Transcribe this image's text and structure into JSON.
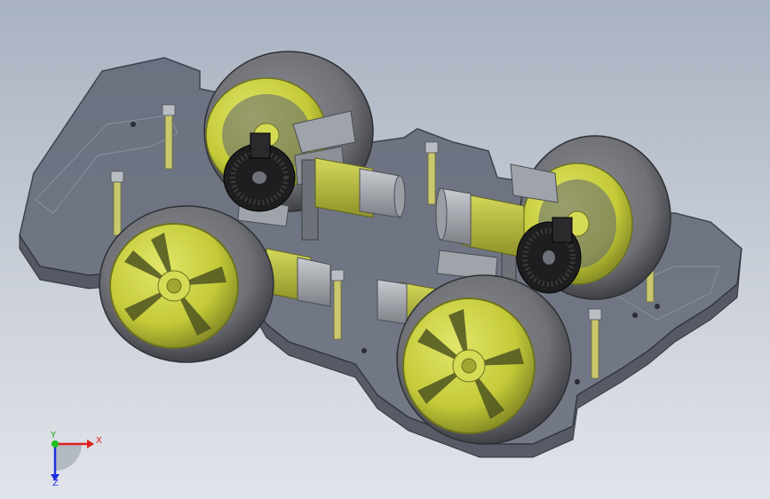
{
  "colors": {
    "background_top": "#a9b2c2",
    "background_bottom": "#e1e4ea",
    "chassis_plate": "#5c6270",
    "chassis_edge": "#3e434e",
    "tire": "#6f7176",
    "tire_dark": "#44464b",
    "rim": "#c8cf3c",
    "rim_dark": "#8c9226",
    "motor_body": "#b6bb3c",
    "motor_cap": "#a3a7ad",
    "bracket": "#8d9096",
    "encoder_disk": "#1e1e20",
    "standoff": "#c9c86e",
    "axis_x": "#e02020",
    "axis_y": "#20c020",
    "axis_z": "#2030e0"
  },
  "icons": {
    "triad": "coordinate-triad-icon"
  },
  "triad": {
    "x_label": "X",
    "y_label": "Y",
    "z_label": "Z"
  }
}
